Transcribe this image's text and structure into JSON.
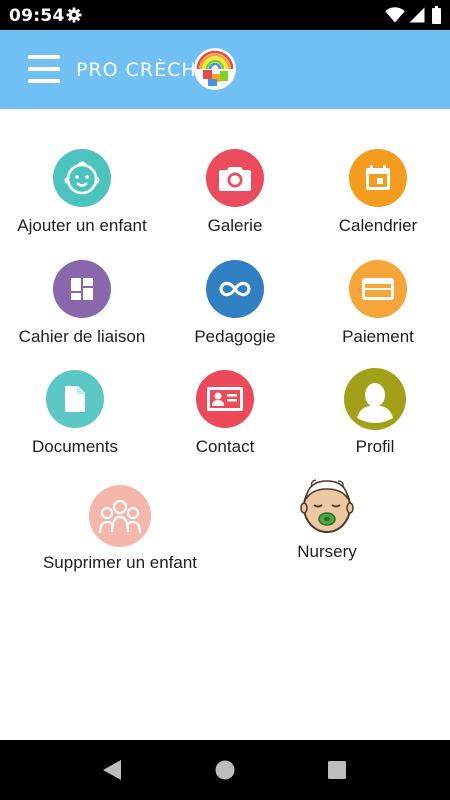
{
  "status_bar": {
    "time": "09:54",
    "icons": [
      "settings-icon",
      "wifi-icon",
      "signal-icon",
      "battery-icon"
    ]
  },
  "header": {
    "brand": "PRO CRÈCHE",
    "background_color": "#71c0f3",
    "icons": [
      "hamburger-menu-icon",
      "pro-creche-logo"
    ]
  },
  "menu": {
    "items": [
      {
        "label": "Ajouter un enfant",
        "icon": "baby-face-icon",
        "color": "#4dc3bf"
      },
      {
        "label": "Galerie",
        "icon": "camera-icon",
        "color": "#ea4c5e"
      },
      {
        "label": "Calendrier",
        "icon": "calendar-icon",
        "color": "#f49c1d"
      },
      {
        "label": "Cahier de liaison",
        "icon": "dashboard-icon",
        "color": "#8a66ad"
      },
      {
        "label": "Pedagogie",
        "icon": "infinity-icon",
        "color": "#2f7fc2"
      },
      {
        "label": "Paiement",
        "icon": "credit-card-icon",
        "color": "#f6a53a"
      },
      {
        "label": "Documents",
        "icon": "document-icon",
        "color": "#5bc8c5"
      },
      {
        "label": "Contact",
        "icon": "id-card-icon",
        "color": "#ec4a5a"
      },
      {
        "label": "Profil",
        "icon": "user-silhouette-icon",
        "color": "#a2a019"
      },
      {
        "label": "Supprimer un enfant",
        "icon": "children-group-icon",
        "color": "#f4b7aa"
      },
      {
        "label": "Nursery",
        "icon": "sleeping-baby-icon",
        "color": "#ffffff"
      }
    ]
  },
  "nav_bar": {
    "icons": [
      "back-icon",
      "home-icon",
      "recents-icon"
    ]
  }
}
